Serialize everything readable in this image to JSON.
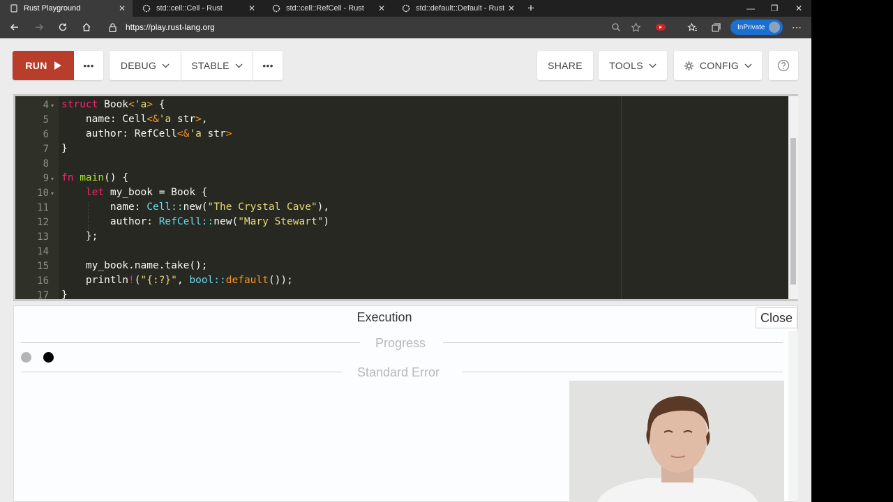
{
  "browser": {
    "tabs": [
      {
        "title": "Rust Playground",
        "active": true
      },
      {
        "title": "std::cell::Cell - Rust",
        "active": false
      },
      {
        "title": "std::cell::RefCell - Rust",
        "active": false
      },
      {
        "title": "std::default::Default - Rust",
        "active": false
      }
    ],
    "url": "https://play.rust-lang.org",
    "inprivate_label": "InPrivate"
  },
  "toolbar": {
    "run_label": "RUN",
    "mode_label": "DEBUG",
    "channel_label": "STABLE",
    "share_label": "SHARE",
    "tools_label": "TOOLS",
    "config_label": "CONFIG"
  },
  "editor": {
    "line_numbers": [
      "4",
      "5",
      "6",
      "7",
      "8",
      "9",
      "10",
      "11",
      "12",
      "13",
      "14",
      "15",
      "16",
      "17"
    ],
    "foldable_lines": [
      "4",
      "9",
      "10"
    ]
  },
  "output": {
    "title": "Execution",
    "close_label": "Close",
    "progress_label": "Progress",
    "stderr_label": "Standard Error"
  },
  "colors": {
    "run_button": "#b83d2a",
    "editor_bg": "#272822",
    "inprivate_badge": "#1a6fd1"
  }
}
